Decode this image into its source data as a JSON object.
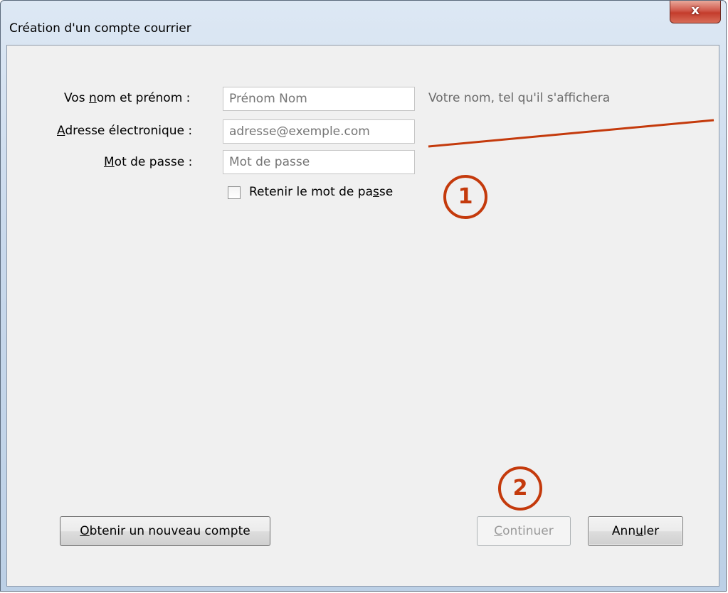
{
  "window": {
    "title": "Création d'un compte courrier",
    "close_glyph": "x"
  },
  "form": {
    "name_label_pre": "Vos ",
    "name_label_ul": "n",
    "name_label_post": "om et prénom :",
    "name_placeholder": "Prénom Nom",
    "name_hint": "Votre nom, tel qu'il s'affichera",
    "email_label_ul": "A",
    "email_label_post": "dresse électronique :",
    "email_placeholder": "adresse@exemple.com",
    "password_label_ul": "M",
    "password_label_post": "ot de passe :",
    "password_placeholder": "Mot de passe",
    "remember_pre": "Retenir le mot de pa",
    "remember_ul": "s",
    "remember_post": "se"
  },
  "buttons": {
    "new_account_ul": "O",
    "new_account_post": "btenir un nouveau compte",
    "continue_ul": "C",
    "continue_post": "ontinuer",
    "cancel_pre": "Ann",
    "cancel_ul": "u",
    "cancel_post": "ler"
  },
  "annotations": {
    "badge_1": "1",
    "badge_2": "2",
    "color": "#c43a0c"
  }
}
